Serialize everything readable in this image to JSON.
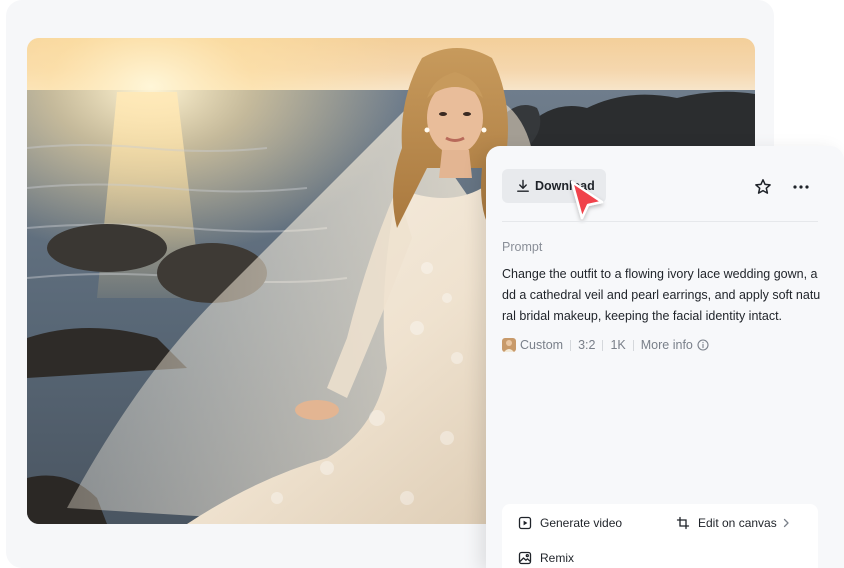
{
  "panel": {
    "download_label": "Download",
    "prompt_label": "Prompt",
    "prompt_text": "Change the outfit to a flowing ivory lace wedding gown, add a cathedral veil and pearl earrings, and apply soft natural bridal makeup, keeping the facial identity intact.",
    "meta": {
      "style": "Custom",
      "ratio": "3:2",
      "resolution": "1K",
      "more_info": "More info"
    },
    "actions": {
      "generate_video": "Generate video",
      "edit_on_canvas": "Edit on canvas",
      "remix": "Remix"
    }
  },
  "icons": {
    "download": "download-icon",
    "star": "star-icon",
    "more": "more-horizontal-icon",
    "info": "info-icon",
    "play": "play-square-icon",
    "crop": "crop-icon",
    "chevron": "chevron-right-icon",
    "remix": "image-remix-icon",
    "cursor": "pointer-cursor"
  },
  "colors": {
    "cursor_red": "#f0434b",
    "panel_bg": "#f7f8fa",
    "button_bg": "#e8eaed"
  }
}
